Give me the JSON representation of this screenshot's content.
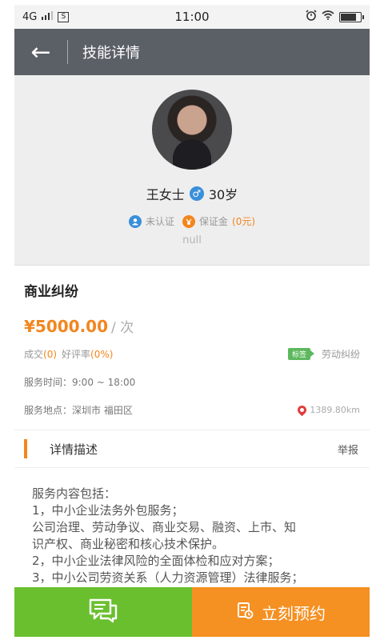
{
  "status_bar": {
    "signal": "4G",
    "sim": "S",
    "time": "11:00"
  },
  "header": {
    "title": "技能详情",
    "back_glyph": "←"
  },
  "profile": {
    "name": "王女士",
    "gender_symbol": "♂",
    "age": "30岁",
    "verify_label": "未认证",
    "deposit_label": "保证金",
    "deposit_amount": "(0元)",
    "bio": "null"
  },
  "service": {
    "title": "商业纠纷",
    "price": "¥5000.00",
    "unit": "/ 次",
    "deals_label": "成交",
    "deals_value": "(0)",
    "rating_label": "好评率",
    "rating_value": "(0%)",
    "tag": "标签",
    "tag_value": "劳动纠纷",
    "time_label": "服务时间：9:00 ~ 18:00",
    "location_label": "服务地点：深圳市 福田区",
    "distance": "1389.80km"
  },
  "details": {
    "section_title": "详情描述",
    "report_label": "举报",
    "lines": [
      "服务内容包括：",
      "1，中小企业法务外包服务；",
      "公司治理、劳动争议、商业交易、融资、上市、知",
      "识产权、商业秘密和核心技术保护。",
      "2，中小企业法律风险的全面体检和应对方案；",
      "3，中小公司劳资关系（人力资源管理）法律服务；"
    ]
  },
  "bottom_bar": {
    "book_label": "立刻预约"
  },
  "colors": {
    "accent": "#f2861e",
    "header_bg": "#5b5f66",
    "chat_green": "#6abf2e",
    "book_orange": "#f59022"
  }
}
